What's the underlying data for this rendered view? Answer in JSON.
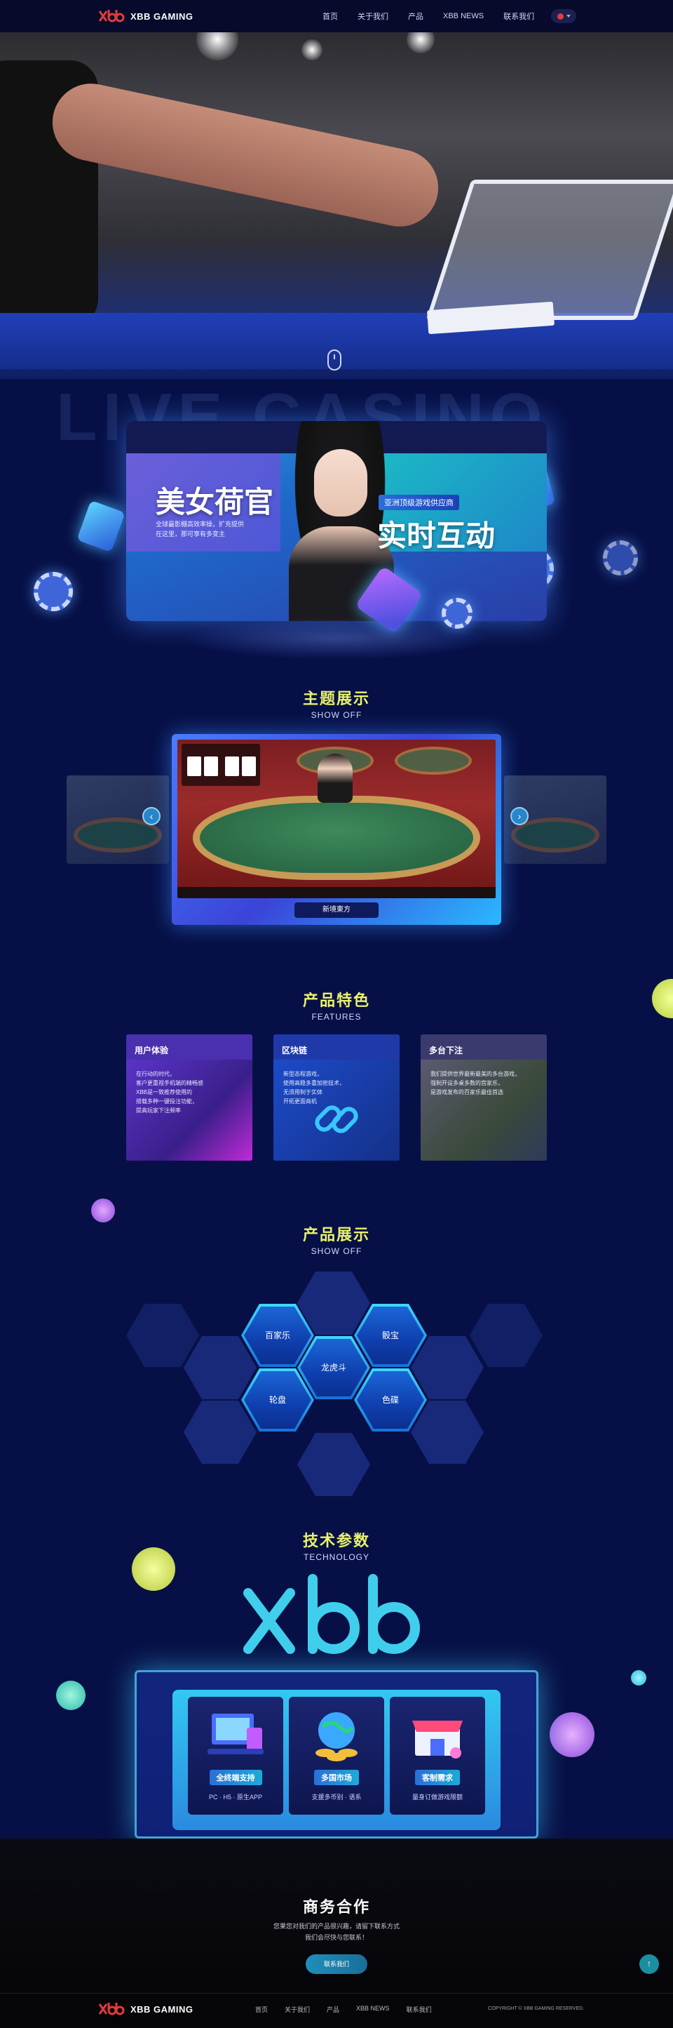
{
  "brand": {
    "name": "XBB GAMING",
    "colors": {
      "accent": "#e23b3b",
      "title_yellow": "#e8f26a",
      "bg": "#071046"
    }
  },
  "nav": {
    "items": [
      "首页",
      "关于我们",
      "产品",
      "XBB NEWS",
      "联系我们"
    ],
    "lang_icon": "flag-icon"
  },
  "hero": {
    "watermark": "LIVE CASINO"
  },
  "banner": {
    "left_title": "美女荷官",
    "left_desc": [
      "全球最影棚高效率操，扩充提供",
      "在这里，那可享有多变主"
    ],
    "tag": "亚洲顶级游戏供应商",
    "right_title": "实时互动"
  },
  "showoff": {
    "cn": "主题展示",
    "en": "SHOW OFF",
    "caption": "新境東方",
    "prev_icon": "chevron-left-icon",
    "next_icon": "chevron-right-icon"
  },
  "features": {
    "cn": "产品特色",
    "en": "FEATURES",
    "cards": [
      {
        "title": "用户体验",
        "lines": [
          "在行动的时代，",
          "客户更重视手机端的精畅感",
          "XBB是一致推荐使用的",
          "搭载多种一键投注功能，",
          "提高玩家下注频率"
        ]
      },
      {
        "title": "区块链",
        "lines": [
          "新型态程游戏，",
          "使用高稳多重加密技术，",
          "无须用制于实体",
          "开拓更面商机"
        ]
      },
      {
        "title": "多台下注",
        "lines": [
          "我们提供世界最新最美的多台游戏，",
          "强制开设多桌多数的宫家乐，",
          "是游戏发布的百家乐最佳首选"
        ]
      }
    ]
  },
  "products": {
    "cn": "产品展示",
    "en": "SHOW OFF",
    "hexes": [
      "百家乐",
      "骰宝",
      "龙虎斗",
      "轮盘",
      "色碟"
    ]
  },
  "technology": {
    "cn": "技术参数",
    "en": "TECHNOLOGY",
    "cards": [
      {
        "title": "全终端支持",
        "sub": "PC · H5 · 原生APP"
      },
      {
        "title": "多国市场",
        "sub": "支援多币别 · 语系"
      },
      {
        "title": "客制需求",
        "sub": "量身订做游戏限额"
      }
    ]
  },
  "footer": {
    "title": "商务合作",
    "lines": [
      "您果您对我们的产品很兴趣，请留下联系方式",
      "我们会尽快与您联系！"
    ],
    "button": "联系我们",
    "top_icon": "arrow-up-icon",
    "links": [
      "首页",
      "关于我们",
      "产品",
      "XBB NEWS",
      "联系我们"
    ],
    "copyright": "COPYRIGHT © XBB GAMING RESERVED."
  }
}
